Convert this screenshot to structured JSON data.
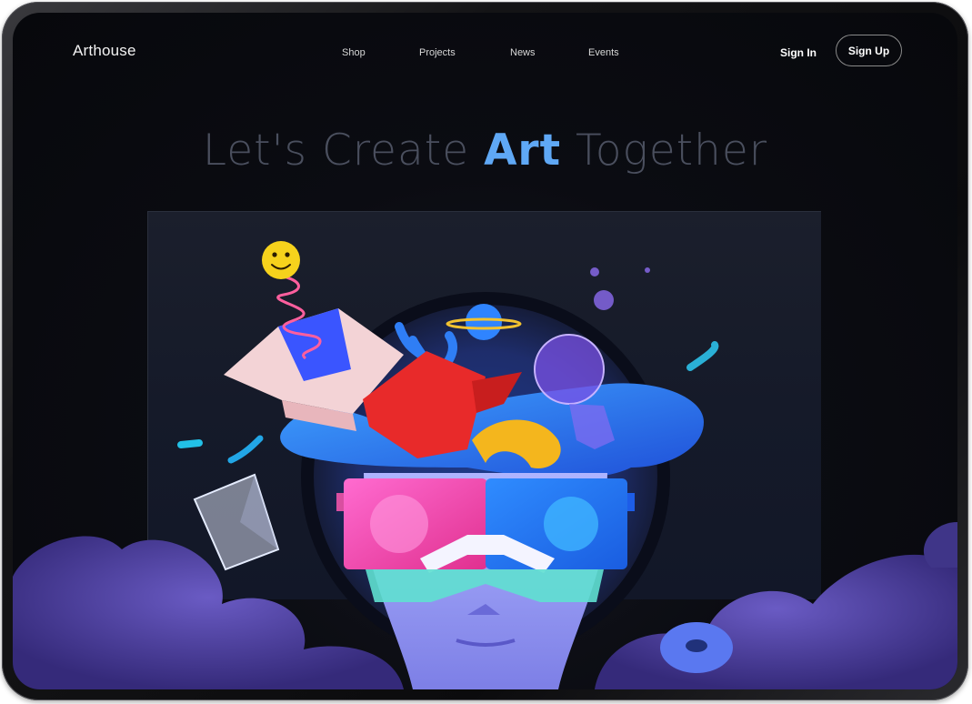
{
  "brand": {
    "name": "Arthouse"
  },
  "nav": {
    "items": [
      {
        "label": "Shop"
      },
      {
        "label": "Projects"
      },
      {
        "label": "News"
      },
      {
        "label": "Events"
      }
    ]
  },
  "auth": {
    "sign_in": "Sign In",
    "sign_up": "Sign Up"
  },
  "hero": {
    "title_before": "Let's Create ",
    "title_accent": "Art",
    "title_after": " Together"
  },
  "colors": {
    "background": "#0b0c12",
    "accent": "#5fa8f5",
    "title_text": "#4a4f5e"
  },
  "icons": {
    "artwork": "3d-head-with-vr-glasses-illustration",
    "smiley": "smiley-face-icon"
  }
}
